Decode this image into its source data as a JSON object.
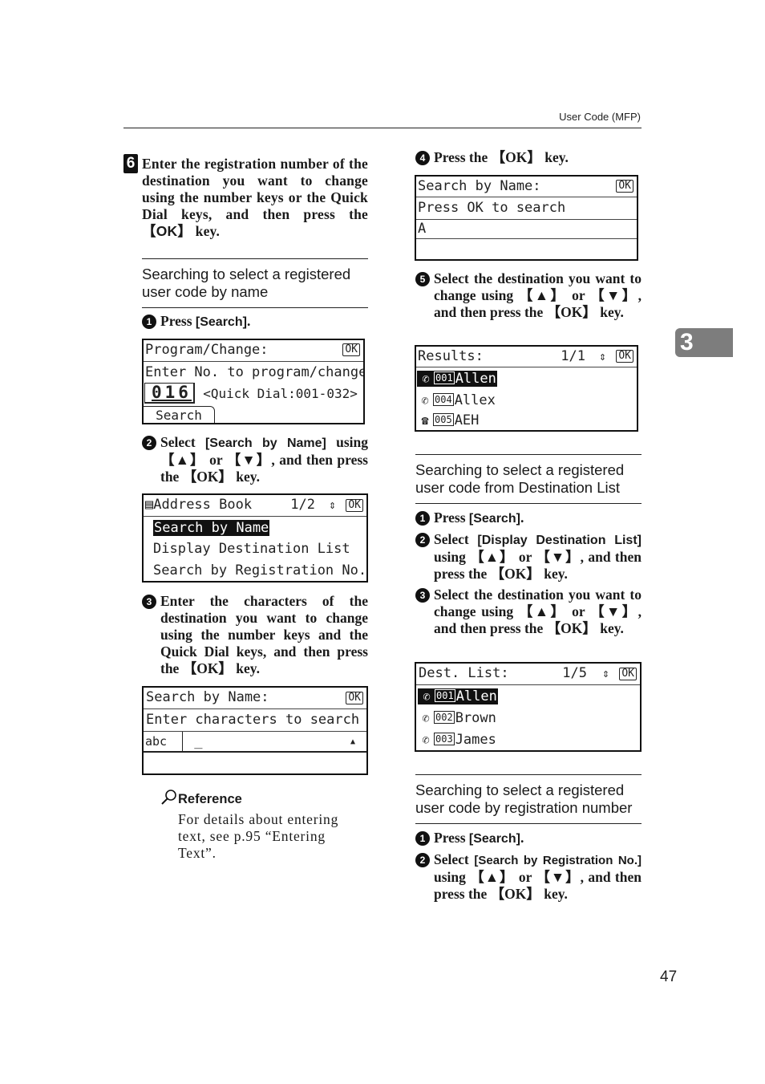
{
  "header": {
    "title": "User Code (MFP)"
  },
  "chapter_tab": "3",
  "page_number": "47",
  "step6": {
    "number": "6",
    "text_before_key": "Enter the registration number of the destination you want to change using the number keys or the Quick Dial keys, and then press the ",
    "key": "【OK】",
    "text_after_key": " key."
  },
  "section_by_name": {
    "heading": "Searching to select a registered user code by name",
    "steps": [
      {
        "num": "1",
        "prefix": "Press ",
        "keyword": "[Search]",
        "suffix": "."
      },
      {
        "num": "2",
        "prefix": "Select ",
        "keyword": "[Search by Name]",
        "suffix": " using 【▲】 or 【▼】, and then press the 【OK】 key."
      },
      {
        "num": "3",
        "prefix": "Enter the characters of the destination you want to change using the number keys and the Quick Dial keys, and then press the 【OK】 key.",
        "keyword": "",
        "suffix": ""
      },
      {
        "num": "4",
        "prefix": "Press the 【OK】 key.",
        "keyword": "",
        "suffix": ""
      },
      {
        "num": "5",
        "prefix": "Select the destination you want to change using 【▲】 or 【▼】, and then press the 【OK】 key.",
        "keyword": "",
        "suffix": ""
      }
    ]
  },
  "lcd_program_change": {
    "title": "Program/Change:",
    "ok": "OK",
    "prompt": "Enter No. to program/change",
    "number_value": "016",
    "range_hint": "<Quick Dial:001-032>",
    "search_button": "Search"
  },
  "lcd_address_book": {
    "title": "Address Book",
    "page": "1/2",
    "ok": "OK",
    "items": [
      {
        "label": "Search by Name",
        "selected": true
      },
      {
        "label": "Display Destination List",
        "selected": false
      },
      {
        "label": "Search by Registration No.",
        "selected": false
      }
    ]
  },
  "lcd_search_name_entry": {
    "title": "Search by Name:",
    "ok": "OK",
    "prompt": "Enter characters to search",
    "mode": "abc",
    "input_value": "_",
    "scroll_indicator": "▲"
  },
  "reference": {
    "title": "Reference",
    "text": "For details about entering text, see p.95 “Entering Text”."
  },
  "lcd_search_name_confirm": {
    "title": "Search by Name:",
    "ok": "OK",
    "prompt": "Press OK to search",
    "input_value": "A",
    "empty_row": ""
  },
  "lcd_results": {
    "title": "Results:",
    "page": "1/1",
    "ok": "OK",
    "items": [
      {
        "icon": "fax-icon",
        "number": "001",
        "name": "Allen",
        "selected": true
      },
      {
        "icon": "fax-icon",
        "number": "004",
        "name": "Allex",
        "selected": false
      },
      {
        "icon": "telephone-icon",
        "number": "005",
        "name": "AEH",
        "selected": false
      }
    ]
  },
  "section_dest_list": {
    "heading": "Searching to select a registered user code from Destination List",
    "steps": [
      {
        "num": "1",
        "prefix": "Press ",
        "keyword": "[Search]",
        "suffix": "."
      },
      {
        "num": "2",
        "prefix": "Select ",
        "keyword": "[Display Destination List]",
        "suffix": " using 【▲】 or 【▼】, and then press the 【OK】 key."
      },
      {
        "num": "3",
        "prefix": "Select the destination you want to change using 【▲】 or 【▼】, and then press the 【OK】 key.",
        "keyword": "",
        "suffix": ""
      }
    ]
  },
  "lcd_dest_list": {
    "title": "Dest. List:",
    "page": "1/5",
    "ok": "OK",
    "items": [
      {
        "icon": "fax-icon",
        "number": "001",
        "name": "Allen",
        "selected": true
      },
      {
        "icon": "fax-icon",
        "number": "002",
        "name": "Brown",
        "selected": false
      },
      {
        "icon": "fax-icon",
        "number": "003",
        "name": "James",
        "selected": false
      }
    ]
  },
  "section_reg_number": {
    "heading": "Searching to select a registered user code by registration number",
    "steps": [
      {
        "num": "1",
        "prefix": "Press ",
        "keyword": "[Search]",
        "suffix": "."
      },
      {
        "num": "2",
        "prefix": "Select ",
        "keyword": "[Search by Registration No.]",
        "suffix": " using 【▲】 or 【▼】, and then press the 【OK】 key."
      }
    ]
  }
}
